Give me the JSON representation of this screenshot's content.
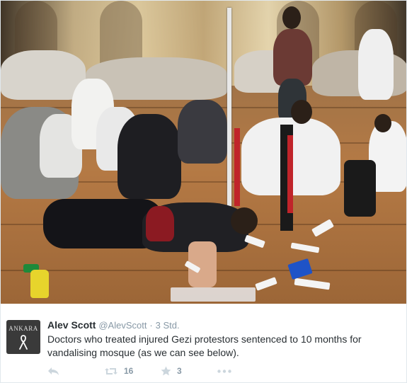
{
  "tweet": {
    "author_name": "Alev Scott",
    "author_handle": "@AlevScott",
    "separator": "·",
    "timestamp": "3 Std.",
    "text": "Doctors who treated injured Gezi protestors sentenced to 10 months for vandalising mosque (as we can see below).",
    "avatar_text": "ANKARA",
    "retweet_count": "16",
    "favorite_count": "3"
  },
  "icons": {
    "reply": "reply-icon",
    "retweet": "retweet-icon",
    "favorite": "star-icon",
    "more": "more-icon",
    "avatar_symbol": "ribbon-icon"
  },
  "colors": {
    "action_icon": "#ccd6dd",
    "secondary_text": "#8899a6",
    "primary_text": "#292f33"
  }
}
